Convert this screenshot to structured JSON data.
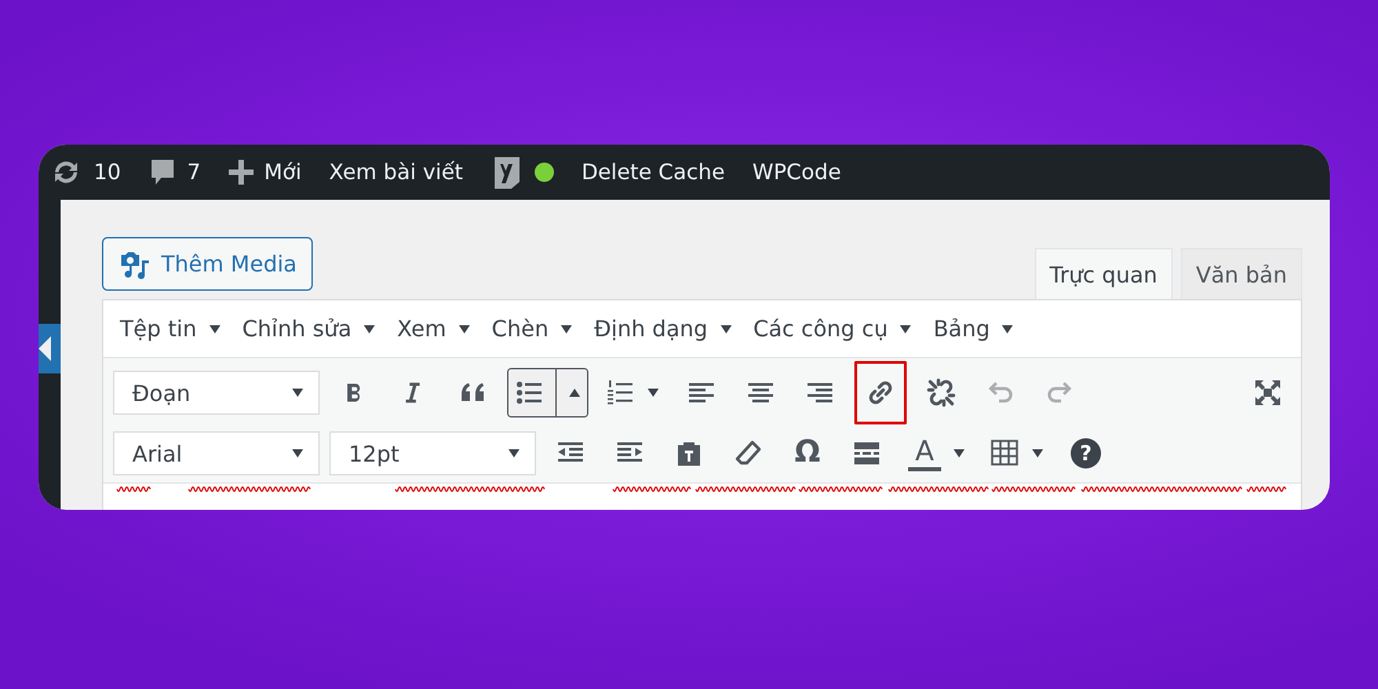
{
  "admin_bar": {
    "items": [
      {
        "kind": "updates",
        "label": "10"
      },
      {
        "kind": "comments",
        "label": "7"
      },
      {
        "kind": "new",
        "label": "Mới"
      },
      {
        "kind": "link",
        "label": "Xem bài viết"
      },
      {
        "kind": "seo",
        "color": "#7ad03a"
      },
      {
        "kind": "link",
        "label": "Delete Cache"
      },
      {
        "kind": "link",
        "label": "WPCode"
      }
    ]
  },
  "add_media_button": {
    "label": "Thêm Media"
  },
  "editor_tabs": [
    {
      "label": "Trực quan",
      "selected": true
    },
    {
      "label": "Văn bản",
      "selected": false
    }
  ],
  "menu_bar": [
    {
      "label": "Tệp tin"
    },
    {
      "label": "Chỉnh sửa"
    },
    {
      "label": "Xem"
    },
    {
      "label": "Chèn"
    },
    {
      "label": "Định dạng"
    },
    {
      "label": "Các công cụ"
    },
    {
      "label": "Bảng"
    }
  ],
  "toolbar_rows": [
    [
      {
        "kind": "select",
        "value": "Đoạn"
      },
      {
        "kind": "bold",
        "active": false,
        "disabled": false,
        "highlighted": false
      },
      {
        "kind": "italic",
        "active": false,
        "disabled": false,
        "highlighted": false
      },
      {
        "kind": "blockquote",
        "active": false,
        "disabled": false,
        "highlighted": false
      },
      {
        "kind": "bullet-list",
        "active": true,
        "disabled": false,
        "highlighted": false
      },
      {
        "kind": "numbered-list",
        "active": false,
        "disabled": false,
        "highlighted": false
      },
      {
        "kind": "align-left",
        "active": false,
        "disabled": false,
        "highlighted": false
      },
      {
        "kind": "align-center",
        "active": false,
        "disabled": false,
        "highlighted": false
      },
      {
        "kind": "align-right",
        "active": false,
        "disabled": false,
        "highlighted": false
      },
      {
        "kind": "link",
        "active": false,
        "disabled": false,
        "highlighted": true
      },
      {
        "kind": "unlink",
        "active": false,
        "disabled": false,
        "highlighted": false
      },
      {
        "kind": "undo",
        "active": false,
        "disabled": true,
        "highlighted": false
      },
      {
        "kind": "redo",
        "active": false,
        "disabled": true,
        "highlighted": false
      },
      {
        "kind": "fullscreen",
        "active": false,
        "disabled": false,
        "highlighted": false
      }
    ],
    [
      {
        "kind": "select",
        "value": "Arial"
      },
      {
        "kind": "select",
        "value": "12pt"
      },
      {
        "kind": "outdent",
        "active": false,
        "disabled": false,
        "highlighted": false
      },
      {
        "kind": "indent",
        "active": false,
        "disabled": false,
        "highlighted": false
      },
      {
        "kind": "paste-text",
        "active": false,
        "disabled": false,
        "highlighted": false
      },
      {
        "kind": "eraser",
        "active": false,
        "disabled": false,
        "highlighted": false
      },
      {
        "kind": "special-char",
        "label": "Ω",
        "active": false,
        "disabled": false,
        "highlighted": false
      },
      {
        "kind": "horizontal-rule",
        "active": false,
        "disabled": false,
        "highlighted": false
      },
      {
        "kind": "text-color",
        "label": "A",
        "active": false,
        "disabled": false,
        "highlighted": false
      },
      {
        "kind": "table",
        "active": false,
        "disabled": false,
        "highlighted": false
      },
      {
        "kind": "help",
        "label": "?",
        "active": false,
        "disabled": false,
        "highlighted": false
      }
    ]
  ]
}
